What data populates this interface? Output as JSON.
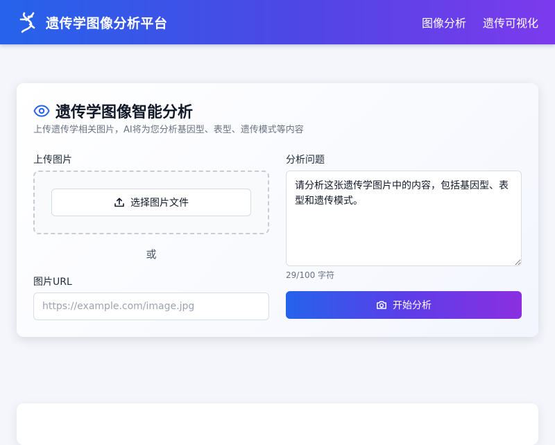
{
  "header": {
    "brand_icon": "dna-icon",
    "title": "遗传学图像分析平台",
    "nav": [
      {
        "label": "图像分析"
      },
      {
        "label": "遗传可视化"
      }
    ],
    "gradient": [
      "#2563eb",
      "#7c3aed"
    ]
  },
  "analysis_card": {
    "icon": "eye-icon",
    "title": "遗传学图像智能分析",
    "subtitle": "上传遗传学相关图片，AI将为您分析基因型、表型、遗传模式等内容",
    "upload": {
      "label": "上传图片",
      "button_label": "选择图片文件",
      "icon": "upload-icon"
    },
    "or_text": "或",
    "url": {
      "label": "图片URL",
      "placeholder": "https://example.com/image.jpg",
      "value": ""
    },
    "question": {
      "label": "分析问题",
      "value": "请分析这张遗传学图片中的内容，包括基因型、表型和遗传模式。",
      "char_count": "29/100 字符"
    },
    "analyze_button": {
      "label": "开始分析",
      "icon": "camera-icon"
    }
  },
  "colors": {
    "accent": "#2563eb",
    "accent_end": "#8b2fe0",
    "background": "#f4f6fb"
  }
}
